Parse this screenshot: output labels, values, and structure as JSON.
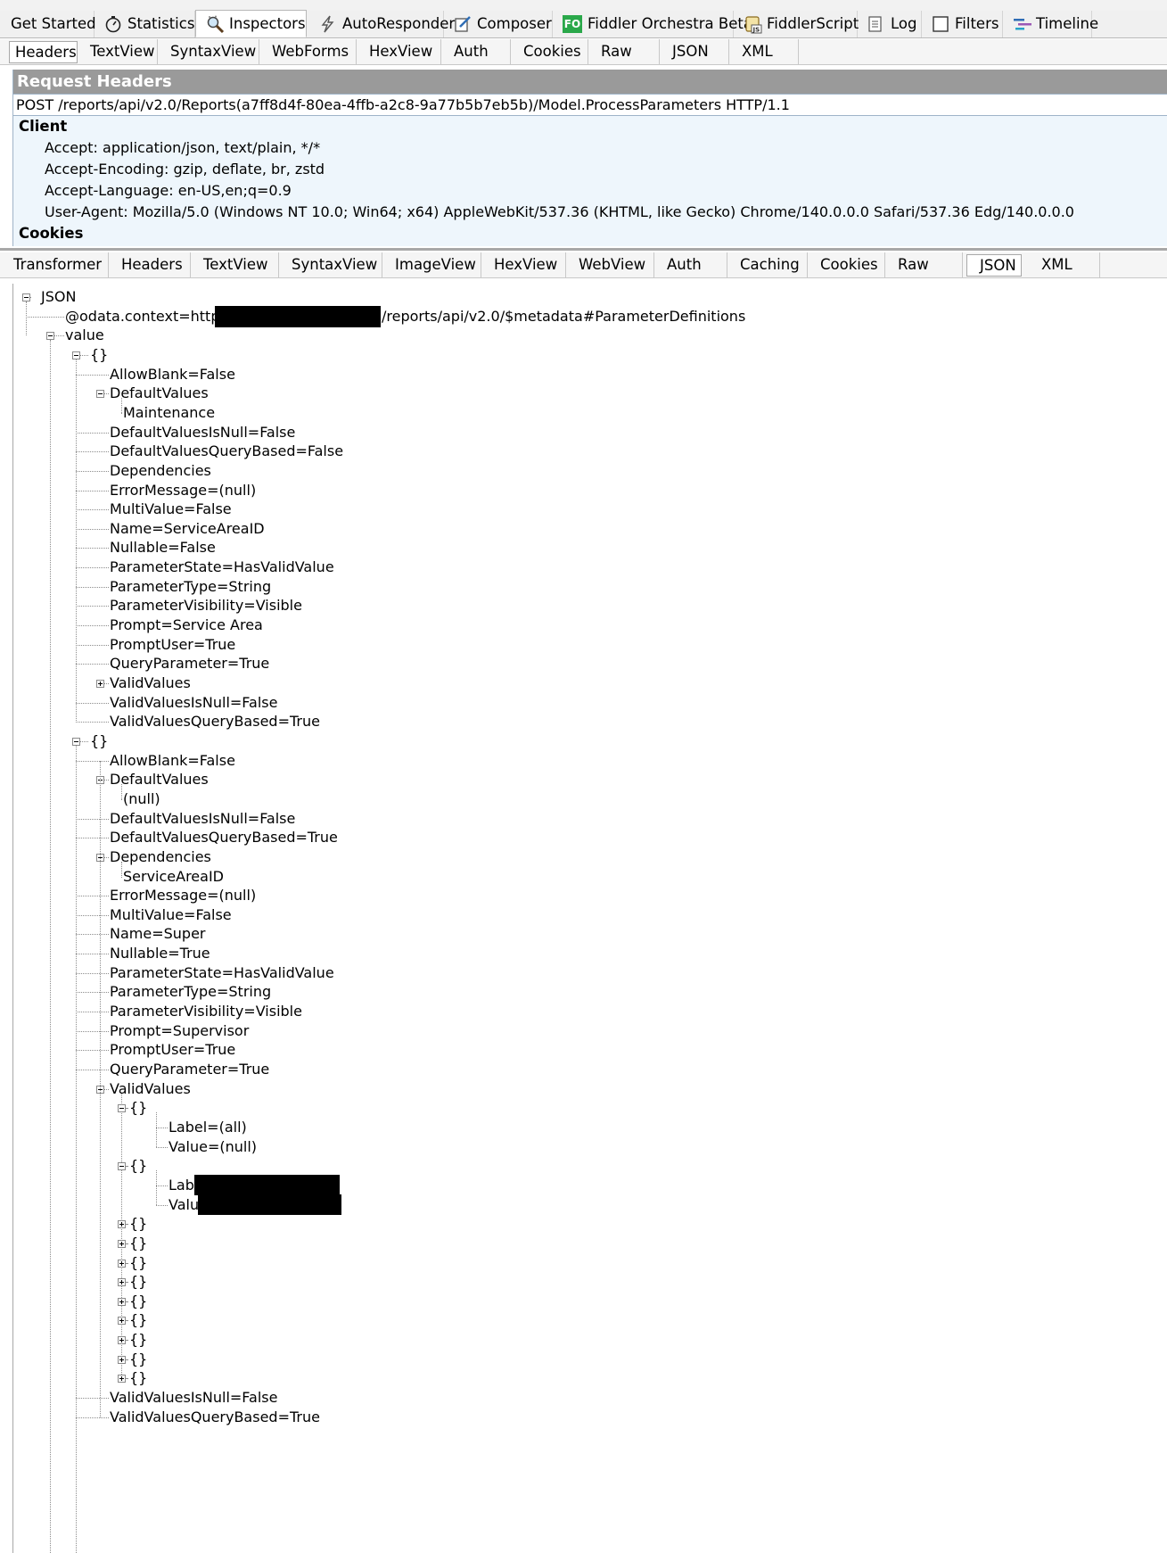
{
  "main_tabs": [
    {
      "label": "Get Started",
      "icon": "none"
    },
    {
      "label": "Statistics",
      "icon": "stopwatch-icon"
    },
    {
      "label": "Inspectors",
      "icon": "magnifier-icon",
      "active": true
    },
    {
      "label": "AutoResponder",
      "icon": "lightning-icon"
    },
    {
      "label": "Composer",
      "icon": "pencil-note-icon"
    },
    {
      "label": "Fiddler Orchestra Beta",
      "icon": "fo-badge-icon",
      "badge": "FO"
    },
    {
      "label": "FiddlerScript",
      "icon": "js-script-icon"
    },
    {
      "label": "Log",
      "icon": "log-icon"
    },
    {
      "label": "Filters",
      "icon": "checkbox-icon"
    },
    {
      "label": "Timeline",
      "icon": "timeline-icon"
    }
  ],
  "request_tabs": [
    "Headers",
    "TextView",
    "SyntaxView",
    "WebForms",
    "HexView",
    "Auth",
    "Cookies",
    "Raw",
    "JSON",
    "XML"
  ],
  "request_selected": "Headers",
  "request_headers": {
    "title": "Request Headers",
    "request_line": "POST /reports/api/v2.0/Reports(a7ff8d4f-80ea-4ffb-a2c8-9a77b5b7eb5b)/Model.ProcessParameters HTTP/1.1",
    "client_group": "Client",
    "client_headers": [
      "Accept: application/json, text/plain, */*",
      "Accept-Encoding: gzip, deflate, br, zstd",
      "Accept-Language: en-US,en;q=0.9",
      "User-Agent: Mozilla/5.0 (Windows NT 10.0; Win64; x64) AppleWebKit/537.36 (KHTML, like Gecko) Chrome/140.0.0.0 Safari/537.36 Edg/140.0.0.0"
    ],
    "cookies_group": "Cookies"
  },
  "response_tabs": [
    "Transformer",
    "Headers",
    "TextView",
    "SyntaxView",
    "ImageView",
    "HexView",
    "WebView",
    "Auth",
    "Caching",
    "Cookies",
    "Raw",
    "JSON",
    "XML"
  ],
  "response_selected": "JSON",
  "tree": {
    "root": "JSON",
    "context_prefix": "@odata.context=https://",
    "context_suffix": "/reports/api/v2.0/$metadata#ParameterDefinitions",
    "value": "value",
    "obj": "{}",
    "item1": [
      "AllowBlank=False",
      "DefaultValues",
      "Maintenance",
      "DefaultValuesIsNull=False",
      "DefaultValuesQueryBased=False",
      "Dependencies",
      "ErrorMessage=(null)",
      "MultiValue=False",
      "Name=ServiceAreaID",
      "Nullable=False",
      "ParameterState=HasValidValue",
      "ParameterType=String",
      "ParameterVisibility=Visible",
      "Prompt=Service Area",
      "PromptUser=True",
      "QueryParameter=True",
      "ValidValues",
      "ValidValuesIsNull=False",
      "ValidValuesQueryBased=True"
    ],
    "item2": [
      "AllowBlank=False",
      "DefaultValues",
      "(null)",
      "DefaultValuesIsNull=False",
      "DefaultValuesQueryBased=True",
      "Dependencies",
      "ServiceAreaID",
      "ErrorMessage=(null)",
      "MultiValue=False",
      "Name=Super",
      "Nullable=True",
      "ParameterState=HasValidValue",
      "ParameterType=String",
      "ParameterVisibility=Visible",
      "Prompt=Supervisor",
      "PromptUser=True",
      "QueryParameter=True",
      "ValidValues"
    ],
    "vv1": [
      "Label=(all)",
      "Value=(null)"
    ],
    "vv2": [
      "Label=",
      "Value="
    ],
    "item2_tail": [
      "ValidValuesIsNull=False",
      "ValidValuesQueryBased=True"
    ]
  }
}
